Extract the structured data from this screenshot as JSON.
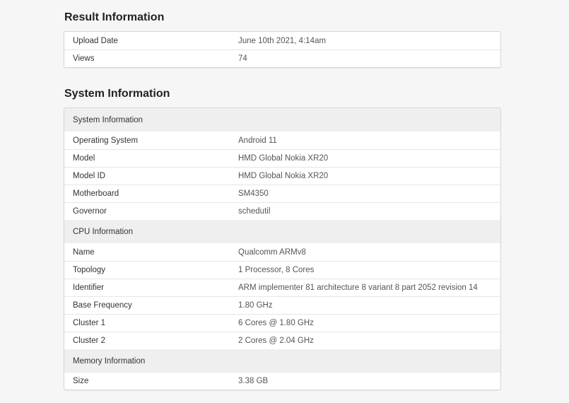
{
  "result": {
    "title": "Result Information",
    "rows": [
      {
        "label": "Upload Date",
        "value": "June 10th 2021, 4:14am"
      },
      {
        "label": "Views",
        "value": "74"
      }
    ]
  },
  "system": {
    "title": "System Information",
    "sections": [
      {
        "header": "System Information",
        "rows": [
          {
            "label": "Operating System",
            "value": "Android 11"
          },
          {
            "label": "Model",
            "value": "HMD Global Nokia XR20"
          },
          {
            "label": "Model ID",
            "value": "HMD Global Nokia XR20"
          },
          {
            "label": "Motherboard",
            "value": "SM4350"
          },
          {
            "label": "Governor",
            "value": "schedutil"
          }
        ]
      },
      {
        "header": "CPU Information",
        "rows": [
          {
            "label": "Name",
            "value": "Qualcomm ARMv8"
          },
          {
            "label": "Topology",
            "value": "1 Processor, 8 Cores"
          },
          {
            "label": "Identifier",
            "value": "ARM implementer 81 architecture 8 variant 8 part 2052 revision 14"
          },
          {
            "label": "Base Frequency",
            "value": "1.80 GHz"
          },
          {
            "label": "Cluster 1",
            "value": "6 Cores @ 1.80 GHz"
          },
          {
            "label": "Cluster 2",
            "value": "2 Cores @ 2.04 GHz"
          }
        ]
      },
      {
        "header": "Memory Information",
        "rows": [
          {
            "label": "Size",
            "value": "3.38 GB"
          }
        ]
      }
    ]
  }
}
